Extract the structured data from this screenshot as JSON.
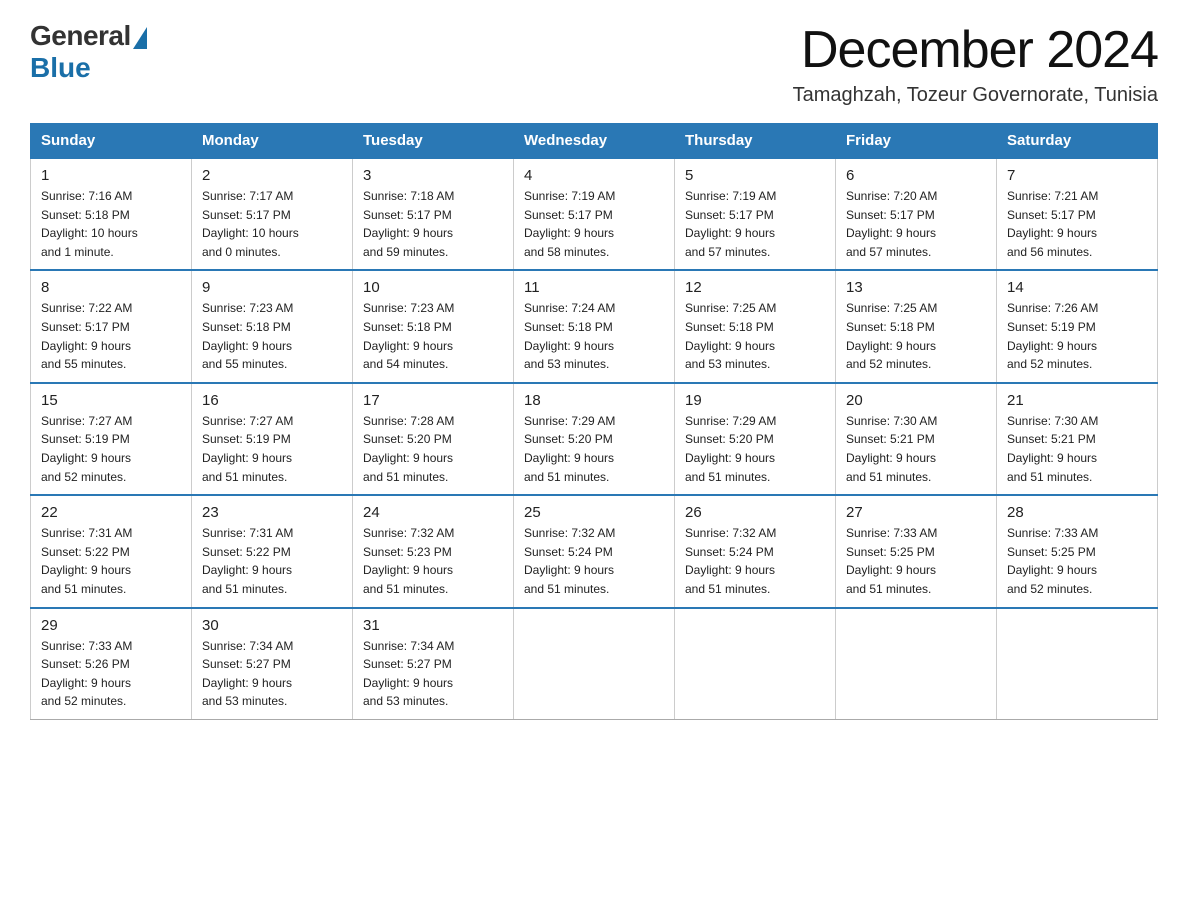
{
  "logo": {
    "general": "General",
    "blue": "Blue"
  },
  "header": {
    "month": "December 2024",
    "location": "Tamaghzah, Tozeur Governorate, Tunisia"
  },
  "days_of_week": [
    "Sunday",
    "Monday",
    "Tuesday",
    "Wednesday",
    "Thursday",
    "Friday",
    "Saturday"
  ],
  "weeks": [
    [
      {
        "day": "1",
        "info": "Sunrise: 7:16 AM\nSunset: 5:18 PM\nDaylight: 10 hours\nand 1 minute."
      },
      {
        "day": "2",
        "info": "Sunrise: 7:17 AM\nSunset: 5:17 PM\nDaylight: 10 hours\nand 0 minutes."
      },
      {
        "day": "3",
        "info": "Sunrise: 7:18 AM\nSunset: 5:17 PM\nDaylight: 9 hours\nand 59 minutes."
      },
      {
        "day": "4",
        "info": "Sunrise: 7:19 AM\nSunset: 5:17 PM\nDaylight: 9 hours\nand 58 minutes."
      },
      {
        "day": "5",
        "info": "Sunrise: 7:19 AM\nSunset: 5:17 PM\nDaylight: 9 hours\nand 57 minutes."
      },
      {
        "day": "6",
        "info": "Sunrise: 7:20 AM\nSunset: 5:17 PM\nDaylight: 9 hours\nand 57 minutes."
      },
      {
        "day": "7",
        "info": "Sunrise: 7:21 AM\nSunset: 5:17 PM\nDaylight: 9 hours\nand 56 minutes."
      }
    ],
    [
      {
        "day": "8",
        "info": "Sunrise: 7:22 AM\nSunset: 5:17 PM\nDaylight: 9 hours\nand 55 minutes."
      },
      {
        "day": "9",
        "info": "Sunrise: 7:23 AM\nSunset: 5:18 PM\nDaylight: 9 hours\nand 55 minutes."
      },
      {
        "day": "10",
        "info": "Sunrise: 7:23 AM\nSunset: 5:18 PM\nDaylight: 9 hours\nand 54 minutes."
      },
      {
        "day": "11",
        "info": "Sunrise: 7:24 AM\nSunset: 5:18 PM\nDaylight: 9 hours\nand 53 minutes."
      },
      {
        "day": "12",
        "info": "Sunrise: 7:25 AM\nSunset: 5:18 PM\nDaylight: 9 hours\nand 53 minutes."
      },
      {
        "day": "13",
        "info": "Sunrise: 7:25 AM\nSunset: 5:18 PM\nDaylight: 9 hours\nand 52 minutes."
      },
      {
        "day": "14",
        "info": "Sunrise: 7:26 AM\nSunset: 5:19 PM\nDaylight: 9 hours\nand 52 minutes."
      }
    ],
    [
      {
        "day": "15",
        "info": "Sunrise: 7:27 AM\nSunset: 5:19 PM\nDaylight: 9 hours\nand 52 minutes."
      },
      {
        "day": "16",
        "info": "Sunrise: 7:27 AM\nSunset: 5:19 PM\nDaylight: 9 hours\nand 51 minutes."
      },
      {
        "day": "17",
        "info": "Sunrise: 7:28 AM\nSunset: 5:20 PM\nDaylight: 9 hours\nand 51 minutes."
      },
      {
        "day": "18",
        "info": "Sunrise: 7:29 AM\nSunset: 5:20 PM\nDaylight: 9 hours\nand 51 minutes."
      },
      {
        "day": "19",
        "info": "Sunrise: 7:29 AM\nSunset: 5:20 PM\nDaylight: 9 hours\nand 51 minutes."
      },
      {
        "day": "20",
        "info": "Sunrise: 7:30 AM\nSunset: 5:21 PM\nDaylight: 9 hours\nand 51 minutes."
      },
      {
        "day": "21",
        "info": "Sunrise: 7:30 AM\nSunset: 5:21 PM\nDaylight: 9 hours\nand 51 minutes."
      }
    ],
    [
      {
        "day": "22",
        "info": "Sunrise: 7:31 AM\nSunset: 5:22 PM\nDaylight: 9 hours\nand 51 minutes."
      },
      {
        "day": "23",
        "info": "Sunrise: 7:31 AM\nSunset: 5:22 PM\nDaylight: 9 hours\nand 51 minutes."
      },
      {
        "day": "24",
        "info": "Sunrise: 7:32 AM\nSunset: 5:23 PM\nDaylight: 9 hours\nand 51 minutes."
      },
      {
        "day": "25",
        "info": "Sunrise: 7:32 AM\nSunset: 5:24 PM\nDaylight: 9 hours\nand 51 minutes."
      },
      {
        "day": "26",
        "info": "Sunrise: 7:32 AM\nSunset: 5:24 PM\nDaylight: 9 hours\nand 51 minutes."
      },
      {
        "day": "27",
        "info": "Sunrise: 7:33 AM\nSunset: 5:25 PM\nDaylight: 9 hours\nand 51 minutes."
      },
      {
        "day": "28",
        "info": "Sunrise: 7:33 AM\nSunset: 5:25 PM\nDaylight: 9 hours\nand 52 minutes."
      }
    ],
    [
      {
        "day": "29",
        "info": "Sunrise: 7:33 AM\nSunset: 5:26 PM\nDaylight: 9 hours\nand 52 minutes."
      },
      {
        "day": "30",
        "info": "Sunrise: 7:34 AM\nSunset: 5:27 PM\nDaylight: 9 hours\nand 53 minutes."
      },
      {
        "day": "31",
        "info": "Sunrise: 7:34 AM\nSunset: 5:27 PM\nDaylight: 9 hours\nand 53 minutes."
      },
      {
        "day": "",
        "info": ""
      },
      {
        "day": "",
        "info": ""
      },
      {
        "day": "",
        "info": ""
      },
      {
        "day": "",
        "info": ""
      }
    ]
  ]
}
